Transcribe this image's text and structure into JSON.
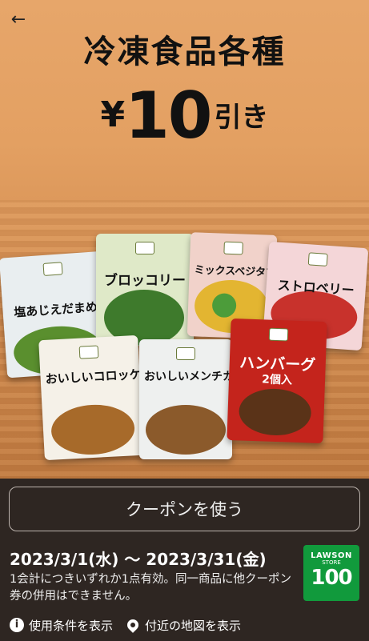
{
  "header": {
    "back_icon": "arrow-left-icon",
    "title": "冷凍食品各種",
    "price_yen": "¥",
    "price_amount": "10",
    "price_suffix": "引き"
  },
  "products": [
    {
      "label": "塩あじえだまめ",
      "color": "#e9eef0"
    },
    {
      "label": "ブロッコリー",
      "color": "#dfe9c8"
    },
    {
      "label": "ミックスベジタブル",
      "color": "#f1d2ca"
    },
    {
      "label": "ストロベリー",
      "color": "#f4d6d8"
    },
    {
      "label": "おいしいコロッケ",
      "color": "#f5f1e8"
    },
    {
      "label": "おいしいメンチカツ",
      "color": "#eef0ef"
    },
    {
      "label": "ハンバーグ",
      "sublabel": "2個入",
      "color": "#c4241c"
    }
  ],
  "coupon": {
    "button_label": "クーポンを使う",
    "dates": "2023/3/1(水) 〜 2023/3/31(金)",
    "note": "1会計につきいずれか1点有効。同一商品に他クーポン券の併用はできません。",
    "store_logo": {
      "line1": "LAWSON",
      "line2": "STORE",
      "line3": "100",
      "color": "#119a3c"
    }
  },
  "links": {
    "terms_icon": "info-icon",
    "terms_label": "使用条件を表示",
    "map_icon": "map-pin-icon",
    "map_label": "付近の地図を表示"
  }
}
